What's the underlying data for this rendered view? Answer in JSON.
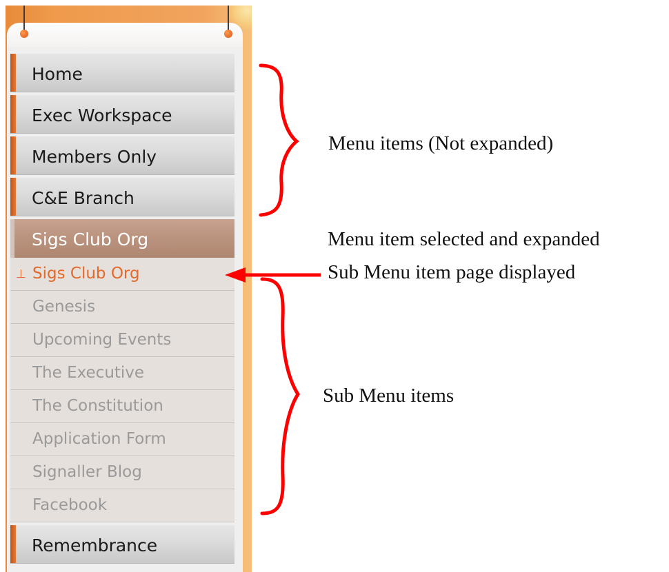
{
  "menu": {
    "items": [
      {
        "label": "Home"
      },
      {
        "label": "Exec Workspace"
      },
      {
        "label": "Members Only"
      },
      {
        "label": "C&E Branch"
      }
    ],
    "selected": {
      "label": "Sigs Club Org"
    },
    "submenu": [
      {
        "label": "Sigs Club Org",
        "active": true
      },
      {
        "label": "Genesis"
      },
      {
        "label": "Upcoming Events"
      },
      {
        "label": "The Executive"
      },
      {
        "label": "The Constitution"
      },
      {
        "label": "Application Form"
      },
      {
        "label": "Signaller Blog"
      },
      {
        "label": "Facebook"
      }
    ],
    "after": [
      {
        "label": "Remembrance"
      }
    ]
  },
  "annotations": {
    "menu_items_note": "Menu items (Not expanded)",
    "selected_note": "Menu item selected and expanded",
    "submenu_page_note": "Sub Menu item page displayed",
    "submenu_items_note": "Sub Menu items"
  },
  "colors": {
    "accent_orange": "#e07b35",
    "selected_bg": "#ba937e",
    "active_sub_text": "#e46a2c",
    "annotation_red": "#ff0000"
  }
}
